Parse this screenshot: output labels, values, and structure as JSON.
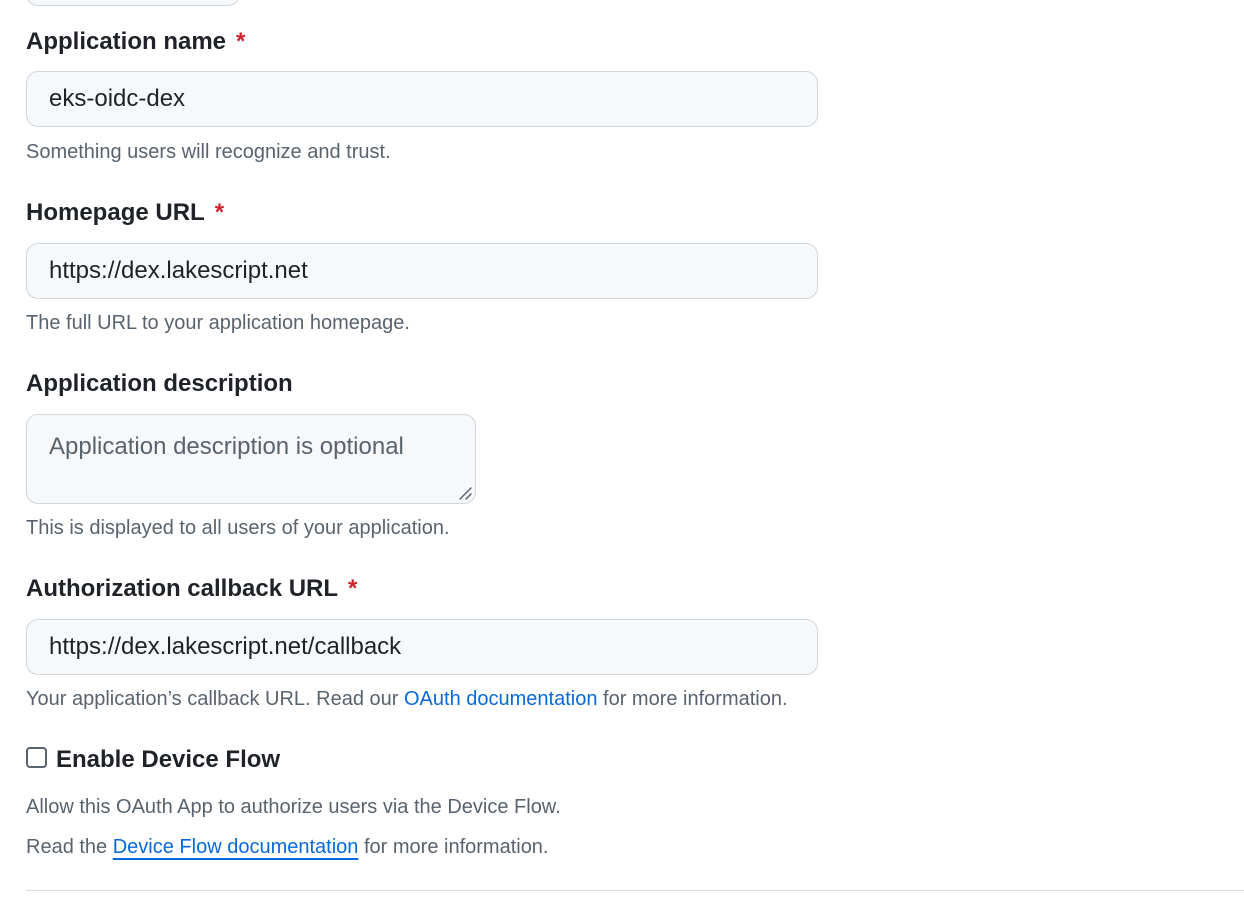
{
  "form": {
    "app_name": {
      "label": "Application name",
      "required_mark": "*",
      "value": "eks-oidc-dex",
      "hint": "Something users will recognize and trust."
    },
    "homepage_url": {
      "label": "Homepage URL",
      "required_mark": "*",
      "value": "https://dex.lakescript.net",
      "hint": "The full URL to your application homepage."
    },
    "description": {
      "label": "Application description",
      "placeholder": "Application description is optional",
      "hint": "This is displayed to all users of your application."
    },
    "callback_url": {
      "label": "Authorization callback URL",
      "required_mark": "*",
      "value": "https://dex.lakescript.net/callback",
      "hint_before": "Your application’s callback URL. Read our ",
      "hint_link": "OAuth documentation",
      "hint_after": " for more information."
    },
    "device_flow": {
      "label": "Enable Device Flow",
      "checked": false,
      "hint": "Allow this OAuth App to authorize users via the Device Flow.",
      "doc_before": "Read the ",
      "doc_link": "Device Flow documentation",
      "doc_after": " for more information."
    }
  },
  "colors": {
    "required": "#cf222e",
    "link": "#0969da",
    "hint_text": "#59636e",
    "field_bg": "#f6f8fa",
    "field_border": "#d0d7de"
  }
}
